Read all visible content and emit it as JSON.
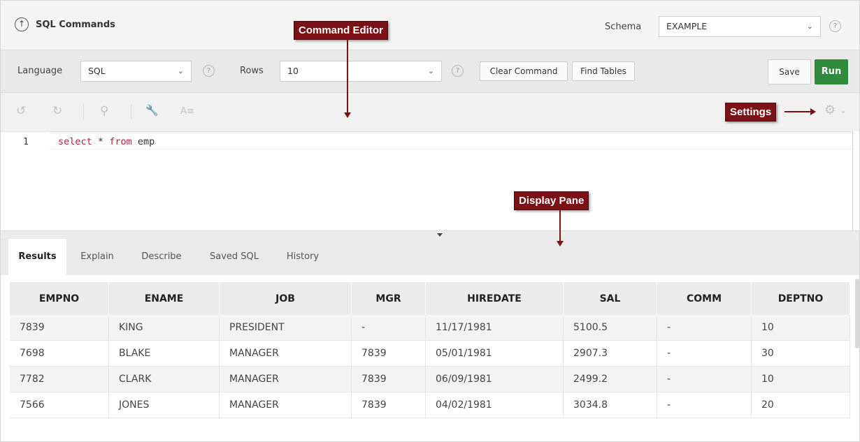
{
  "header": {
    "title": "SQL Commands",
    "schema_label": "Schema",
    "schema_value": "EXAMPLE"
  },
  "toolbar": {
    "language_label": "Language",
    "language_value": "SQL",
    "rows_label": "Rows",
    "rows_value": "10",
    "clear_label": "Clear Command",
    "find_label": "Find Tables",
    "save_label": "Save",
    "run_label": "Run"
  },
  "editor": {
    "line_number": "1",
    "tokens": [
      "select",
      "*",
      "from",
      "emp"
    ]
  },
  "tabs": [
    "Results",
    "Explain",
    "Describe",
    "Saved SQL",
    "History"
  ],
  "results": {
    "columns": [
      "EMPNO",
      "ENAME",
      "JOB",
      "MGR",
      "HIREDATE",
      "SAL",
      "COMM",
      "DEPTNO"
    ],
    "rows": [
      [
        "7839",
        "KING",
        "PRESIDENT",
        "-",
        "11/17/1981",
        "5100.5",
        "-",
        "10"
      ],
      [
        "7698",
        "BLAKE",
        "MANAGER",
        "7839",
        "05/01/1981",
        "2907.3",
        "-",
        "30"
      ],
      [
        "7782",
        "CLARK",
        "MANAGER",
        "7839",
        "06/09/1981",
        "2499.2",
        "-",
        "10"
      ],
      [
        "7566",
        "JONES",
        "MANAGER",
        "7839",
        "04/02/1981",
        "3034.8",
        "-",
        "20"
      ]
    ]
  },
  "callouts": {
    "command_editor": "Command Editor",
    "settings": "Settings",
    "display_pane": "Display Pane"
  },
  "icons": {
    "help": "?",
    "chevron": "⌄",
    "up_arrow": "↑",
    "undo": "↺",
    "redo": "↻",
    "search": "⚲",
    "wrench": "🔧",
    "format": "A≡",
    "gear": "⚙"
  },
  "colors": {
    "run_button": "#2f8a3e",
    "callout": "#7b1016",
    "keyword": "#b6223c"
  }
}
